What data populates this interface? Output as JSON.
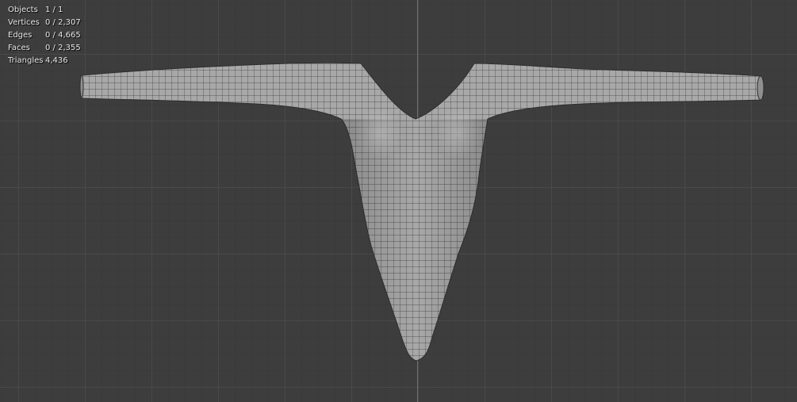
{
  "stats": {
    "objects": {
      "label": "Objects",
      "value": "1 / 1"
    },
    "vertices": {
      "label": "Vertices",
      "value": "0 / 2,307"
    },
    "edges": {
      "label": "Edges",
      "value": "0 / 4,665"
    },
    "faces": {
      "label": "Faces",
      "value": "0 / 2,355"
    },
    "triangles": {
      "label": "Triangles",
      "value": "4,436"
    }
  },
  "colors": {
    "viewport_background": "#3d3d3d",
    "grid_minor": "#3a3a3a",
    "grid_major": "#4a4a4a",
    "axis_line": "#4a73c4",
    "mesh_surface": "#a8a8a8",
    "wireframe": "#3c3c3c"
  },
  "icons": {}
}
